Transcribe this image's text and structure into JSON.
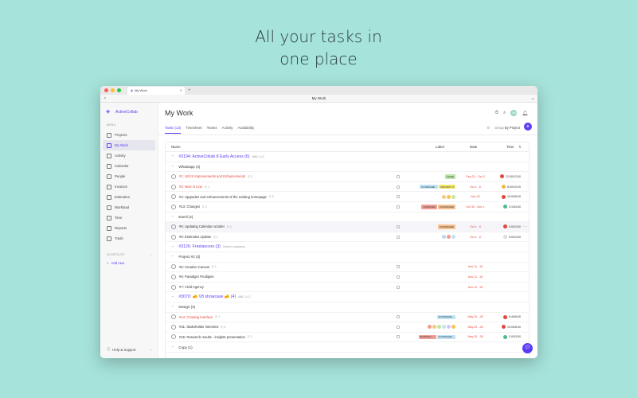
{
  "hero": {
    "line1": "All your tasks in",
    "line2": "one place"
  },
  "window": {
    "tab_title": "My Work",
    "nav_title": "My Work",
    "dots": [
      "#fe5f57",
      "#febc2e",
      "#28c840"
    ]
  },
  "sidebar": {
    "brand": "ActiveCollab",
    "menu_label": "MENU",
    "items": [
      {
        "label": "Projects",
        "icon": "grid-icon"
      },
      {
        "label": "My Work",
        "icon": "user-icon",
        "active": true
      },
      {
        "label": "Activity",
        "icon": "activity-icon"
      },
      {
        "label": "Calendar",
        "icon": "calendar-icon"
      },
      {
        "label": "People",
        "icon": "people-icon"
      },
      {
        "label": "Invoices",
        "icon": "invoice-icon"
      },
      {
        "label": "Estimates",
        "icon": "estimate-icon"
      },
      {
        "label": "Workload",
        "icon": "workload-icon"
      },
      {
        "label": "Time",
        "icon": "clock-icon"
      },
      {
        "label": "Reports",
        "icon": "reports-icon"
      },
      {
        "label": "Trash",
        "icon": "trash-icon"
      }
    ],
    "shortcuts_label": "SHORTCUTS",
    "add_new": "Add new",
    "help": "Help & Support"
  },
  "main": {
    "title": "My Work",
    "avatar_initials": "SM",
    "tabs": [
      "Tasks (13)",
      "Timesheet",
      "Teams",
      "Activity",
      "Availability"
    ],
    "group_by_label": "Group",
    "group_by_value": "By Project",
    "columns": {
      "name": "Name",
      "label": "Label",
      "date": "Date",
      "time": "Time"
    }
  },
  "rows": [
    {
      "kind": "project",
      "name": "#3194: ActiveCollab 8 Early Access (6)",
      "client": "ABC LLC"
    },
    {
      "kind": "group",
      "name": "Whatsapp (4)"
    },
    {
      "kind": "task",
      "name": "#1: UI/UX Improvements and Enhancements",
      "meta": "3",
      "red": true,
      "labels": [
        {
          "t": "DONE",
          "c": "#b9e6a7"
        }
      ],
      "date": "Sep 21 - Oct 3",
      "time": "12:00/12:00",
      "tc": "#e2473b"
    },
    {
      "kind": "task",
      "name": "#3: Next in Line",
      "meta": "1",
      "red": true,
      "labels": [
        {
          "t": "IN PROGRE...",
          "c": "#bfe3f7"
        },
        {
          "t": "PRIORITY 2",
          "c": "#f4e66b"
        }
      ],
      "date": "Oct 1 - 6",
      "time": "8:00/10:00",
      "tc": "#f1b93c"
    },
    {
      "kind": "task",
      "name": "#4: Upgrades and enhancements of the existing homepage",
      "meta": "2",
      "dots": [
        "#f5c97c",
        "#f6c44c",
        "#c6e5a0"
      ],
      "date": "Nov 20",
      "time": "10:00/8:00",
      "tc": "#e2473b"
    },
    {
      "kind": "task",
      "name": "#13: Changes",
      "meta": "1",
      "labels": [
        {
          "t": "ASSIGNED",
          "c": "#f2a097"
        },
        {
          "t": "CONFIRMED",
          "c": "#f7c290"
        }
      ],
      "date": "Oct 30 - Nov 1",
      "time": "3:15/4:00",
      "tc": "#4dbb8a"
    },
    {
      "kind": "group",
      "name": "Eamil (2)"
    },
    {
      "kind": "task",
      "name": "#5: Updating Calendar october",
      "meta": "1",
      "hl": true,
      "labels": [
        {
          "t": "CONFIRMED",
          "c": "#f7c290"
        }
      ],
      "date": "Oct 1 - 6",
      "time": "3:00/3:00",
      "tc": "#e2473b",
      "more": true
    },
    {
      "kind": "task",
      "name": "#6: Estimates Update",
      "meta": "1",
      "dots": [
        "#b9d6f2",
        "#f19a8e",
        "#bfe3f7"
      ],
      "date": "Oct 1 - 6",
      "time": "0:00/3:00",
      "tc": "#dddddd"
    },
    {
      "kind": "project",
      "name": "#3126: Freelancers (3)",
      "client": "Owner company"
    },
    {
      "kind": "group",
      "name": "Project #2 (3)"
    },
    {
      "kind": "task",
      "name": "#5: Creative Canvas",
      "meta": "1",
      "date": "Nov 11 - 15"
    },
    {
      "kind": "task",
      "name": "#6: Paradigm Prodigies",
      "date": "Nov 11 - 15"
    },
    {
      "kind": "task",
      "name": "#7: Vivid Agency",
      "date": "Nov 11 - 15"
    },
    {
      "kind": "project",
      "name": "#3070: 🧀 V8 showcase 🧀 (4)",
      "client": "ABC LLC"
    },
    {
      "kind": "group",
      "name": "Design (3)"
    },
    {
      "kind": "task",
      "name": "#14: Creating interface",
      "meta": "1",
      "red": true,
      "labels": [
        {
          "t": "IN PROGRE...",
          "c": "#bfe3f7"
        }
      ],
      "date": "May 20 - 28",
      "time": "9:40/8:00",
      "tc": "#e2473b"
    },
    {
      "kind": "task",
      "name": "#31: Stakeholder interview",
      "meta": "3",
      "dots": [
        "#f19a8e",
        "#f5c97c",
        "#c6e5a0",
        "#bfe3f7",
        "#d8c7f5",
        "#f6c44c"
      ],
      "date": "May 20 - 28",
      "time": "10:00/8:00",
      "tc": "#e2473b"
    },
    {
      "kind": "task",
      "name": "#15: Research results - insights presentation",
      "meta": "1",
      "labels": [
        {
          "t": "BURNING I...",
          "c": "#f2a097"
        },
        {
          "t": "IN PROGRE...",
          "c": "#bfe3f7"
        }
      ],
      "date": "May 20 - 28",
      "time": "2:00/3:00",
      "tc": "#4dbb8a"
    },
    {
      "kind": "group",
      "name": "Copy (1)"
    }
  ],
  "colors": {
    "accent": "#5b3df5",
    "background": "#a6e3da"
  }
}
